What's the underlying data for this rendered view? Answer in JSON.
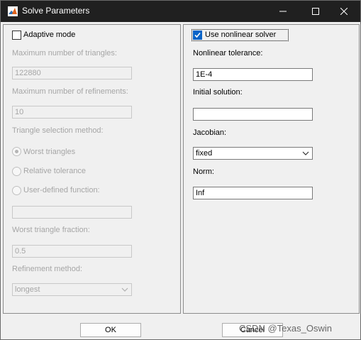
{
  "window": {
    "title": "Solve Parameters"
  },
  "left": {
    "adaptive_label": "Adaptive mode",
    "max_triangles_label": "Maximum number of triangles:",
    "max_triangles_value": "122880",
    "max_refinements_label": "Maximum number of refinements:",
    "max_refinements_value": "10",
    "triangle_selection_label": "Triangle selection method:",
    "radio_worst": "Worst triangles",
    "radio_relative": "Relative tolerance",
    "radio_userdef": "User-defined function:",
    "userdef_value": "",
    "worst_fraction_label": "Worst triangle fraction:",
    "worst_fraction_value": "0.5",
    "refinement_method_label": "Refinement method:",
    "refinement_method_value": "longest"
  },
  "right": {
    "nonlinear_label": "Use nonlinear solver",
    "tolerance_label": "Nonlinear tolerance:",
    "tolerance_value": "1E-4",
    "initial_label": "Initial solution:",
    "initial_value": "",
    "jacobian_label": "Jacobian:",
    "jacobian_value": "fixed",
    "norm_label": "Norm:",
    "norm_value": "Inf"
  },
  "footer": {
    "ok_label": "OK",
    "cancel_label": "Cancel"
  },
  "watermark": "CSDN @Texas_Oswin",
  "colors": {
    "titlebar": "#202020",
    "accent": "#0a64c8",
    "disabled_text": "#a6a6a6"
  }
}
